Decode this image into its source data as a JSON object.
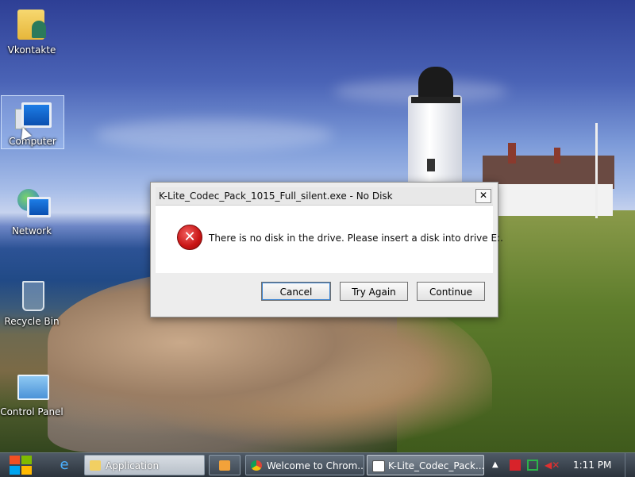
{
  "desktop": {
    "icons": [
      {
        "label": "Vkontakte",
        "icon": "user-folder-icon"
      },
      {
        "label": "Computer",
        "icon": "computer-icon"
      },
      {
        "label": "Network",
        "icon": "network-icon"
      },
      {
        "label": "Recycle Bin",
        "icon": "recycle-bin-icon"
      },
      {
        "label": "Control Panel",
        "icon": "control-panel-icon"
      }
    ]
  },
  "dialog": {
    "title": "K-Lite_Codec_Pack_1015_Full_silent.exe - No Disk",
    "close_glyph": "✕",
    "error_glyph": "✕",
    "message": "There is no disk in the drive. Please insert a disk into drive E:.",
    "buttons": {
      "cancel": "Cancel",
      "try_again": "Try Again",
      "continue": "Continue"
    }
  },
  "taskbar": {
    "tasks": [
      {
        "label": "Application",
        "icon": "folder-icon"
      },
      {
        "label": "",
        "icon": "media-player-icon"
      },
      {
        "label": "Welcome to Chrom...",
        "icon": "chrome-icon"
      },
      {
        "label": "K-Lite_Codec_Pack...",
        "icon": "window-icon"
      }
    ],
    "clock": "1:11 PM",
    "colors": {
      "accent": "#3a82d0",
      "error_red": "#c81414"
    }
  }
}
